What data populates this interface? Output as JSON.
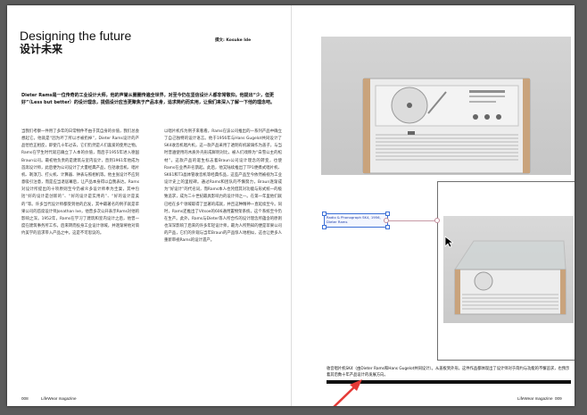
{
  "spread": {
    "title_en": "Designing the future",
    "title_cn": "设计未来",
    "author": "撰文: Kosuke Ide",
    "lead": "Dieter Rams是一位传奇的工业设计大师，他的声誉从圈圈传遍全世界，对至今仍在坚信设计人都非常敬仰。他提出“少，但更好”（Less but better）的设计理念，提倡设计应当更聚焦于产品本身，追求简约而实用，让我们来深入了解一下他的理念吧。",
    "col1": "当我们考察一件用了多年的日常物件不由于其自身的价值，我们总会想起它。他就是“因为坏了所以才被扔掉”，Dieter Rams设计的产品恰恰正相反，即使几十年过去，它们仍然是人们喜爱的使用之物。Rams在学生时代就已确立了人本的价值，而后于1955年进入德国Braun公司。最初他负责的是建筑与室内设计，直到1961年他成为首席设计师，此后便为公司设计了大量经典产品，包括收音机、唱片机、剃须刀、打火机、计算器、钟表与照相机等。他主张设计不应刻意吸引注意，而是应当退居幕后，让产品本身得以自我表达。Rams对设计所提出的十项原则至今仍被众多设计师奉为圭臬，其中包括“好的设计是创新的”、“好的设计是实用的”、“好的设计是美的”等。许多当代设计师都受到他的启发，其中最著名的例子就是苹果公司的首席设计师Jonathan Ive，他曾多次公开表示Rams对他的影响之深。1952年，Rams在学习了建筑和室内设计之后，他曾一度在建筑事务所工作，后来转而投身工业设计领域，并逐渐将他对简约美学的追求带入产品之中。这是不可思议的。",
    "col2": "以唱片机作为例子来看看，Rams在该公司推出的一系列产品中确立了自己独特的设计语言。他于1956年与Hans Gugelot共同设计了SK4收音机唱片机，这一款产品采用了透明有机玻璃作为盖子，与当时普遍使用的木质外壳形成鲜明对比，被人们戏称为“白雪公主的棺材”。这款产品的诞生标志着Braun公司设计理念的转变，也使Rams在业界声名鹊起。此后，他又陆续推出了TP1便携式唱片机、SK61和T3晶体管收音机等经典作品，这些产品至今依然被视为工业设计史上的里程碑。通过Rams和团队的不懈努力，Braun逐渐成为“好设计”的代名词，而Rams本人也凭借其对功能与形式统一的极致追求，成为二十世纪最具影响力的设计师之一。在第一年里他们就已经在多个领域取得了显著的成就，并且这种精神一直延续至今。同时，Rams还推出了Vitsoe的606通用置物架系统，这个系统至今仍在生产。此外，Rams与Dieter等人所合作的设计理念所蕴含的原则也深深影响了后来的许多年轻设计师，最为人所熟知的便是苹果公司的产品，它们的外观与当年Braun的产品惊人地相似，这也让更多人重新审视Rams的设计遗产。",
    "selected_caption": "Radio & Phonograph SK4, 1956, Dieter Rams",
    "image_caption": "收音唱片机SK4（由Dieter Rams和Hans Gugelot共同设计）。从盖板到外形，这件作品都体现出了设计师对于简约与功能的不懈追求，也预示着其后数十年产品设计的发展方向。",
    "folio_left_num": "008",
    "folio_left_mag": "LifeWear magazine",
    "folio_right_mag": "LifeWear magazine",
    "folio_right_num": "009"
  },
  "icons": [
    "mouse-cursor-icon",
    "annotation-arrow-icon",
    "link-handle-icon"
  ],
  "colors": {
    "background": "#5b5b5b",
    "selection": "#3b6fd6",
    "annotation": "#e53935",
    "link": "#c28c9a"
  }
}
